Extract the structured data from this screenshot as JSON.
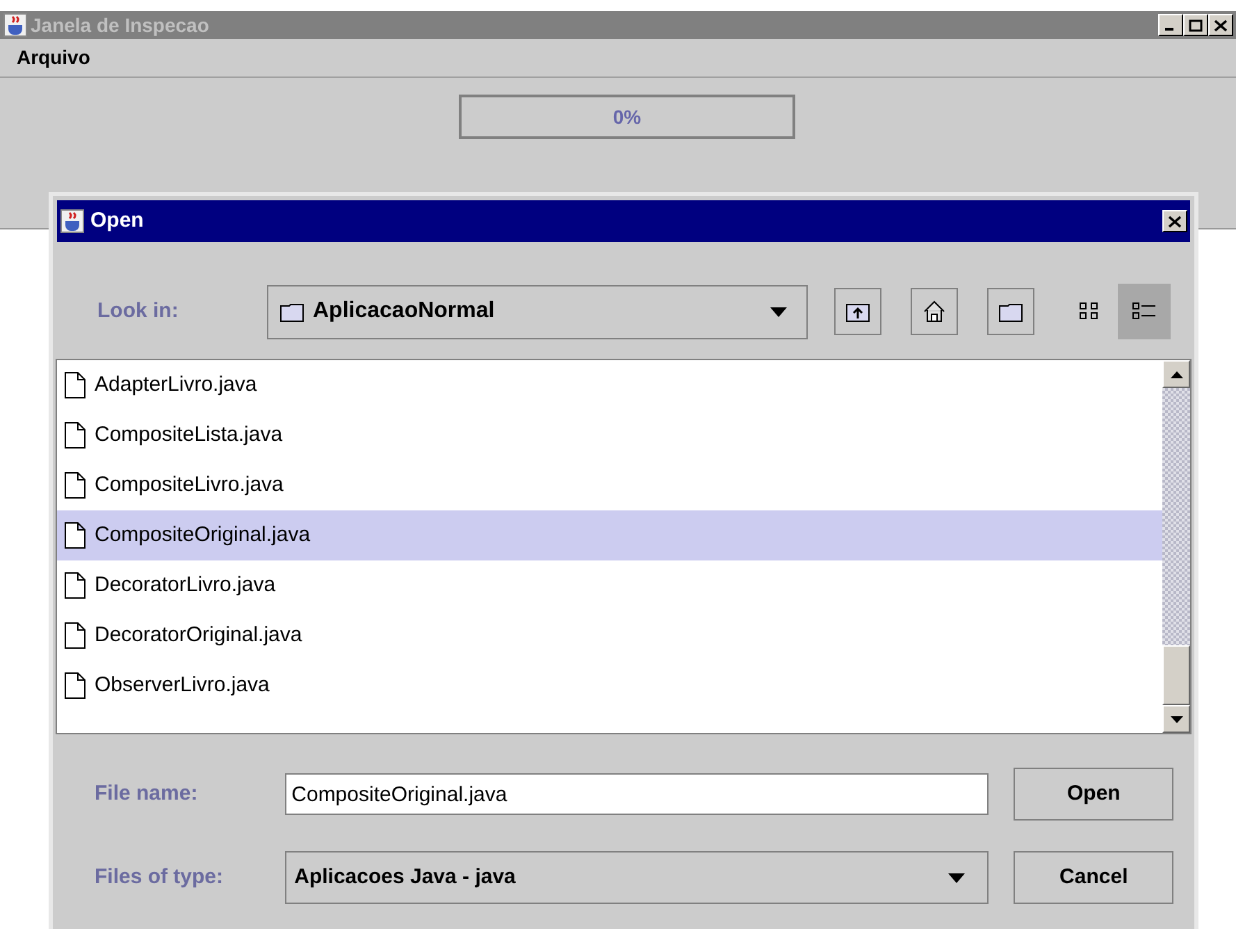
{
  "main_window": {
    "title": "Janela de Inspecao",
    "menu": [
      {
        "label": "Arquivo"
      }
    ],
    "progress": {
      "level": 0,
      "reading": "0%"
    }
  },
  "dialog": {
    "title": "Open",
    "look_in": {
      "label": "Look in:",
      "value": "AplicacaoNormal"
    },
    "toolbar": [
      {
        "kind": "up",
        "selected": false
      },
      {
        "kind": "home",
        "selected": false
      },
      {
        "kind": "new-folder",
        "selected": false
      },
      {
        "kind": "list",
        "selected": false
      },
      {
        "kind": "details",
        "selected": true
      }
    ],
    "files": [
      {
        "name": "AdapterLivro.java",
        "selected": false
      },
      {
        "name": "CompositeLista.java",
        "selected": false
      },
      {
        "name": "CompositeLivro.java",
        "selected": false
      },
      {
        "name": "CompositeOriginal.java",
        "selected": true
      },
      {
        "name": "DecoratorLivro.java",
        "selected": false
      },
      {
        "name": "DecoratorOriginal.java",
        "selected": false
      },
      {
        "name": "ObserverLivro.java",
        "selected": false
      }
    ],
    "file_name": {
      "label": "File name:",
      "value": "CompositeOriginal.java"
    },
    "file_type": {
      "label": "Files of type:",
      "value": "Aplicacoes Java - java"
    },
    "buttons": [
      {
        "label": "Open"
      },
      {
        "label": "Cancel"
      }
    ]
  }
}
